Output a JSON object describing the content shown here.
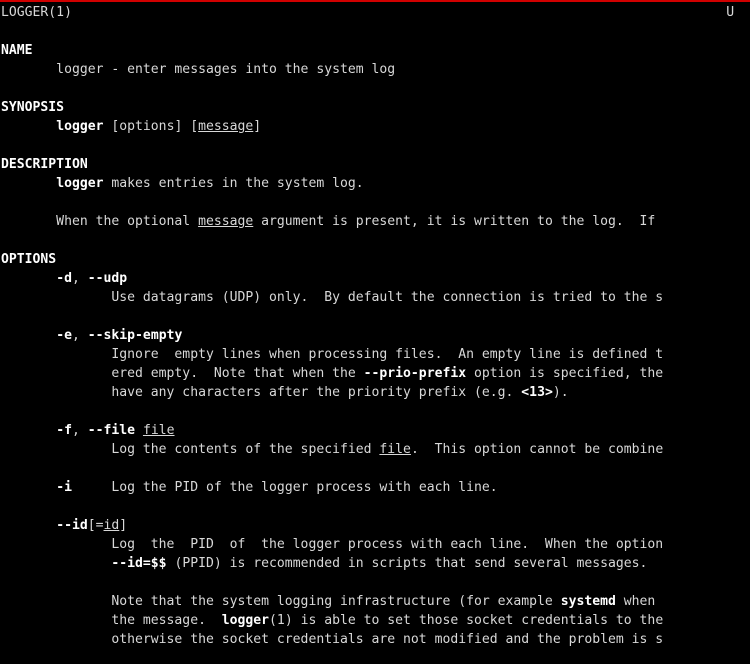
{
  "terminal": {
    "accent_color": "#d00000",
    "lines": [
      [
        {
          "t": "LOGGER(1)                                                                                   U"
        }
      ],
      [],
      [
        {
          "t": "NAME",
          "s": "b"
        }
      ],
      [
        {
          "t": "       logger - enter messages into the system log"
        }
      ],
      [],
      [
        {
          "t": "SYNOPSIS",
          "s": "b"
        }
      ],
      [
        {
          "t": "       "
        },
        {
          "t": "logger",
          "s": "b"
        },
        {
          "t": " [options] ["
        },
        {
          "t": "message",
          "s": "u"
        },
        {
          "t": "]"
        }
      ],
      [],
      [
        {
          "t": "DESCRIPTION",
          "s": "b"
        }
      ],
      [
        {
          "t": "       "
        },
        {
          "t": "logger",
          "s": "b"
        },
        {
          "t": " makes entries in the system log."
        }
      ],
      [],
      [
        {
          "t": "       When the optional "
        },
        {
          "t": "message",
          "s": "u"
        },
        {
          "t": " argument is present, it is written to the log.  If"
        }
      ],
      [],
      [
        {
          "t": "OPTIONS",
          "s": "b"
        }
      ],
      [
        {
          "t": "       "
        },
        {
          "t": "-d",
          "s": "b"
        },
        {
          "t": ", "
        },
        {
          "t": "--udp",
          "s": "b"
        }
      ],
      [
        {
          "t": "              Use datagrams (UDP) only.  By default the connection is tried to the s"
        }
      ],
      [],
      [
        {
          "t": "       "
        },
        {
          "t": "-e",
          "s": "b"
        },
        {
          "t": ", "
        },
        {
          "t": "--skip-empty",
          "s": "b"
        }
      ],
      [
        {
          "t": "              Ignore  empty lines when processing files.  An empty line is defined t"
        }
      ],
      [
        {
          "t": "              ered empty.  Note that when the "
        },
        {
          "t": "--prio-prefix",
          "s": "b"
        },
        {
          "t": " option is specified, the"
        }
      ],
      [
        {
          "t": "              have any characters after the priority prefix (e.g. "
        },
        {
          "t": "<13>",
          "s": "b"
        },
        {
          "t": ")."
        }
      ],
      [],
      [
        {
          "t": "       "
        },
        {
          "t": "-f",
          "s": "b"
        },
        {
          "t": ", "
        },
        {
          "t": "--file",
          "s": "b"
        },
        {
          "t": " "
        },
        {
          "t": "file",
          "s": "u"
        }
      ],
      [
        {
          "t": "              Log the contents of the specified "
        },
        {
          "t": "file",
          "s": "u"
        },
        {
          "t": ".  This option cannot be combine"
        }
      ],
      [],
      [
        {
          "t": "       "
        },
        {
          "t": "-i",
          "s": "b"
        },
        {
          "t": "     Log the PID of the logger process with each line."
        }
      ],
      [],
      [
        {
          "t": "       "
        },
        {
          "t": "--id",
          "s": "b"
        },
        {
          "t": "[="
        },
        {
          "t": "id",
          "s": "u"
        },
        {
          "t": "]"
        }
      ],
      [
        {
          "t": "              Log  the  PID  of  the logger process with each line.  When the option"
        }
      ],
      [
        {
          "t": "              "
        },
        {
          "t": "--id=$$",
          "s": "b"
        },
        {
          "t": " (PPID) is recommended in scripts that send several messages."
        }
      ],
      [],
      [
        {
          "t": "              Note that the system logging infrastructure (for example "
        },
        {
          "t": "systemd",
          "s": "b"
        },
        {
          "t": " when"
        }
      ],
      [
        {
          "t": "              the message.  "
        },
        {
          "t": "logger",
          "s": "b"
        },
        {
          "t": "(1) is able to set those socket credentials to the"
        }
      ],
      [
        {
          "t": "              otherwise the socket credentials are not modified and the problem is s"
        }
      ]
    ]
  }
}
